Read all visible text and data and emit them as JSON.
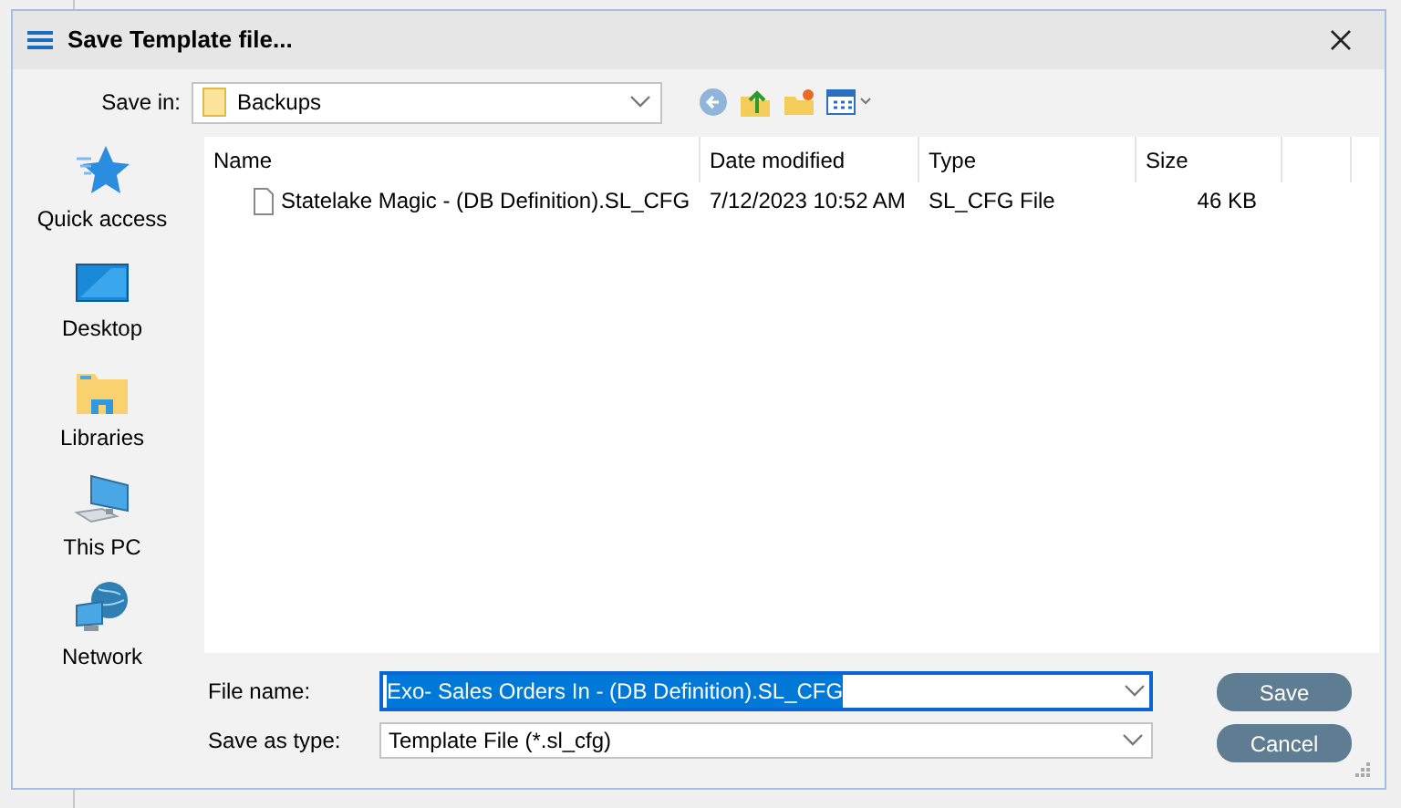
{
  "window": {
    "title": "Save Template file..."
  },
  "save_in": {
    "label": "Save in:",
    "value": "Backups"
  },
  "places": [
    {
      "label": "Quick access",
      "kind": "star"
    },
    {
      "label": "Desktop",
      "kind": "desktop"
    },
    {
      "label": "Libraries",
      "kind": "library"
    },
    {
      "label": "This PC",
      "kind": "pc"
    },
    {
      "label": "Network",
      "kind": "network"
    }
  ],
  "table": {
    "columns": [
      "Name",
      "Date modified",
      "Type",
      "Size"
    ],
    "rows": [
      {
        "name": "Statelake Magic - (DB Definition).SL_CFG",
        "date": "7/12/2023 10:52 AM",
        "type": "SL_CFG File",
        "size": "46 KB",
        "selected": false
      }
    ]
  },
  "file_name": {
    "label": "File name:",
    "value": "Exo- Sales Orders In - (DB Definition).SL_CFG",
    "selected": true
  },
  "save_as_type": {
    "label": "Save as type:",
    "value": "Template File (*.sl_cfg)"
  },
  "buttons": [
    "Save",
    "Cancel"
  ]
}
